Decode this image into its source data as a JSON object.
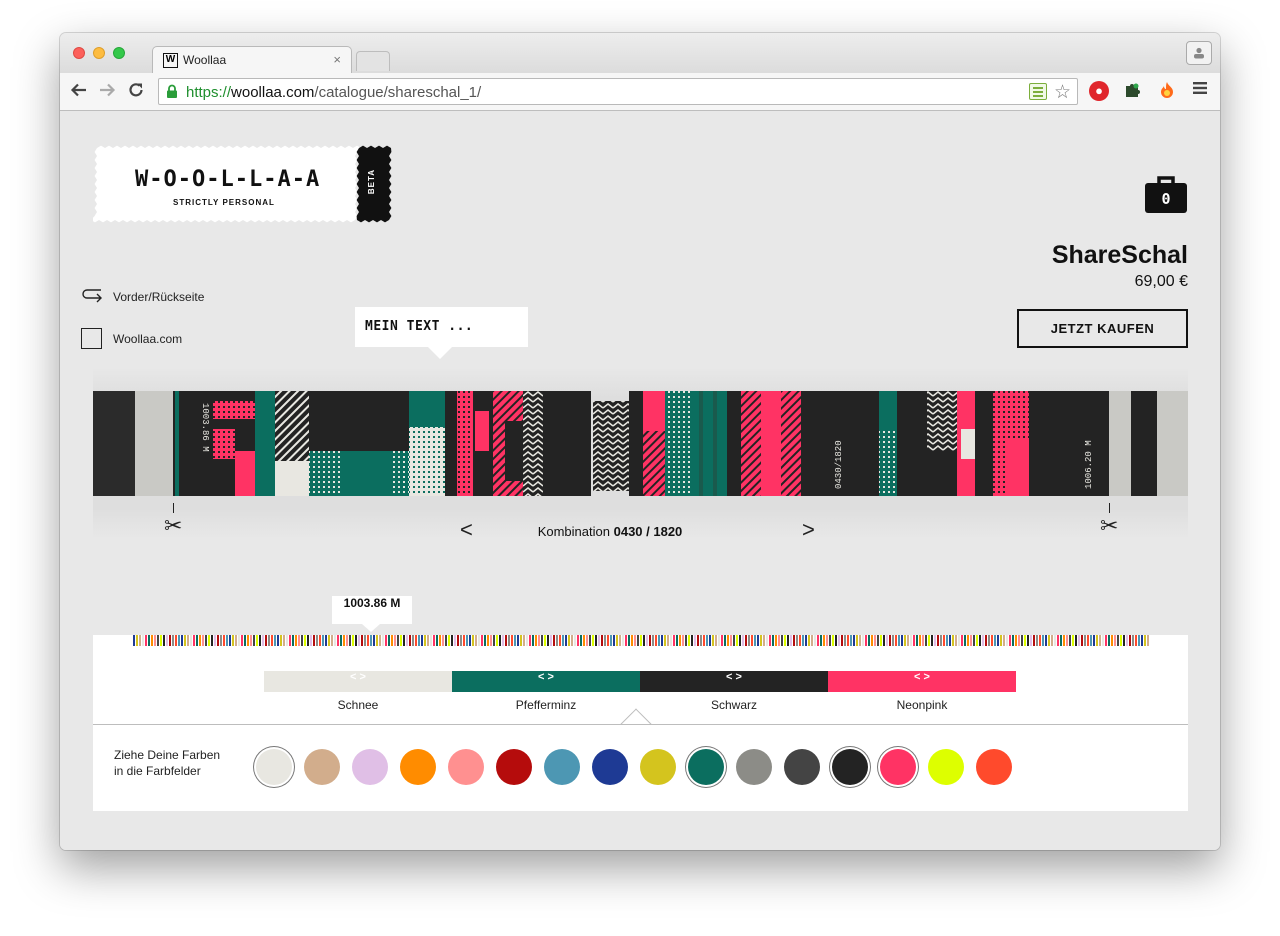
{
  "browser": {
    "tab_title": "Woollaa",
    "tab_favicon": "W",
    "tab_close": "×",
    "url_scheme": "https://",
    "url_host": "woollaa.com",
    "url_path": "/catalogue/shareschal_1/"
  },
  "brand": {
    "wordmark": "W-O-O-L-L-A-A",
    "tagline": "STRICTLY PERSONAL",
    "beta": "BETA"
  },
  "cart": {
    "count": "0"
  },
  "product": {
    "title": "ShareSchal",
    "price": "69,00 €",
    "buy_label": "JETZT KAUFEN"
  },
  "options": {
    "flip_label": "Vorder/Rückseite",
    "website_label": "Woollaa.com"
  },
  "text_bubble": {
    "placeholder": "MEIN TEXT ..."
  },
  "scarf": {
    "start_marker": "1003.86 M",
    "mid_marker": "0430/1820",
    "end_marker": "1006.20 M"
  },
  "combination": {
    "prefix": "Kombination",
    "value": "0430 / 1820",
    "prev": "<",
    "next": ">"
  },
  "timeline": {
    "position_label": "1003.86 M"
  },
  "color_slots": [
    {
      "name": "Schnee",
      "color": "#e8e7e1",
      "handle": "< >",
      "handle_color": "#ffffff"
    },
    {
      "name": "Pfefferminz",
      "color": "#0b6e5f",
      "handle": "< >",
      "handle_color": "#ffffff"
    },
    {
      "name": "Schwarz",
      "color": "#232323",
      "handle": "< >",
      "handle_color": "#ffffff"
    },
    {
      "name": "Neonpink",
      "color": "#ff3364",
      "handle": "< >",
      "handle_color": "#ffffff"
    }
  ],
  "palette": {
    "instruction": "Ziehe Deine Farben in die Farbfelder",
    "swatches": [
      {
        "name": "swatch-schnee",
        "color": "#e8e7e1",
        "selected": true
      },
      {
        "name": "swatch-sand",
        "color": "#d2ad8c",
        "selected": false
      },
      {
        "name": "swatch-flieder",
        "color": "#e0bfe6",
        "selected": false
      },
      {
        "name": "swatch-orange",
        "color": "#ff8c00",
        "selected": false
      },
      {
        "name": "swatch-rosa",
        "color": "#ff9090",
        "selected": false
      },
      {
        "name": "swatch-rot",
        "color": "#b50c0c",
        "selected": false
      },
      {
        "name": "swatch-petrol",
        "color": "#4d97b3",
        "selected": false
      },
      {
        "name": "swatch-blau",
        "color": "#1e3a94",
        "selected": false
      },
      {
        "name": "swatch-senf",
        "color": "#d4c41e",
        "selected": false
      },
      {
        "name": "swatch-pfefferminz",
        "color": "#0b6e5f",
        "selected": true
      },
      {
        "name": "swatch-grau",
        "color": "#8c8c87",
        "selected": false
      },
      {
        "name": "swatch-anthrazit",
        "color": "#444444",
        "selected": false
      },
      {
        "name": "swatch-schwarz",
        "color": "#232323",
        "selected": true
      },
      {
        "name": "swatch-neonpink",
        "color": "#ff3364",
        "selected": true
      },
      {
        "name": "swatch-neongelb",
        "color": "#ddff00",
        "selected": false
      },
      {
        "name": "swatch-neonorange",
        "color": "#ff4a2c",
        "selected": false
      }
    ]
  }
}
